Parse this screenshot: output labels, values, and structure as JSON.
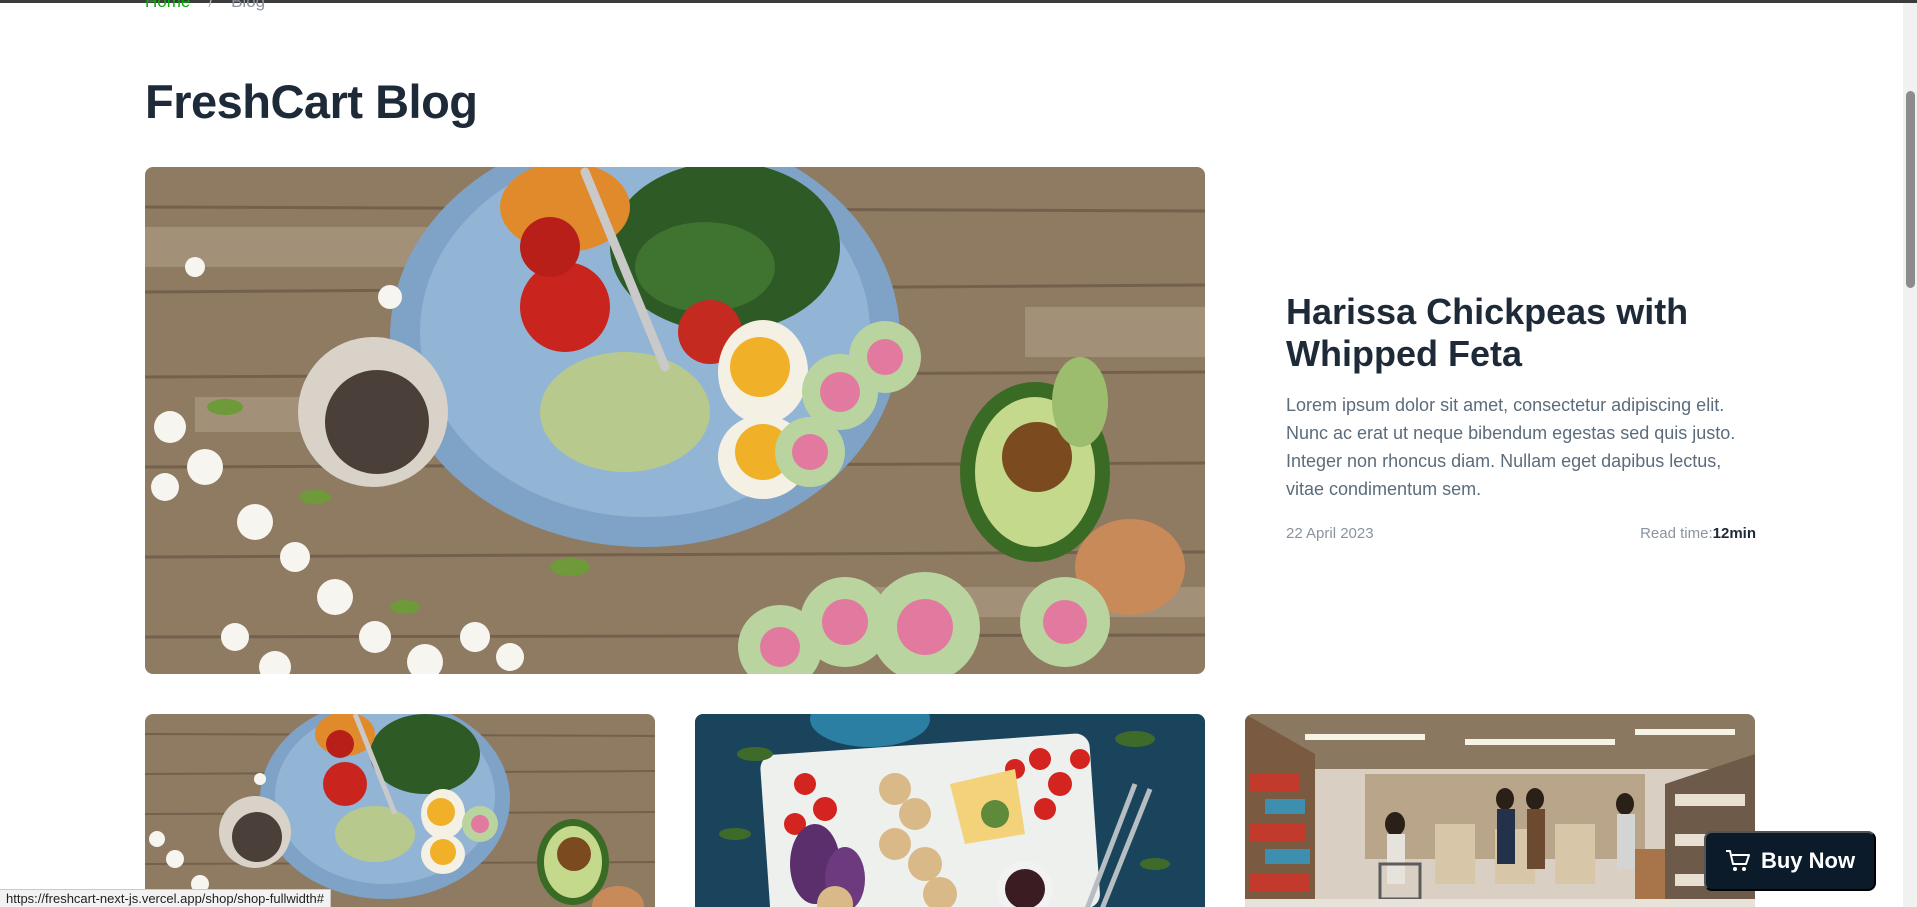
{
  "breadcrumb": {
    "home": "Home",
    "separator": "/",
    "current": "Blog"
  },
  "page": {
    "title": "FreshCart Blog"
  },
  "featured": {
    "title": "Harissa Chickpeas with Whipped Feta",
    "description": "Lorem ipsum dolor sit amet, consectetur adipiscing elit. Nunc ac erat ut neque bibendum egestas sed quis justo. Integer non rhoncus diam. Nullam eget dapibus lectus, vitae condimentum sem.",
    "date": "22 April 2023",
    "read_time_label": "Read time:",
    "read_time_value": "12min"
  },
  "buy_now": {
    "label": "Buy Now",
    "icon": "cart-icon"
  },
  "status_bar": {
    "url": "https://freshcart-next-js.vercel.app/shop/shop-fullwidth#"
  },
  "colors": {
    "accent": "#0aad0a",
    "dark": "#0b1b2a",
    "text": "#1e2a38",
    "muted": "#5c6c7b"
  }
}
